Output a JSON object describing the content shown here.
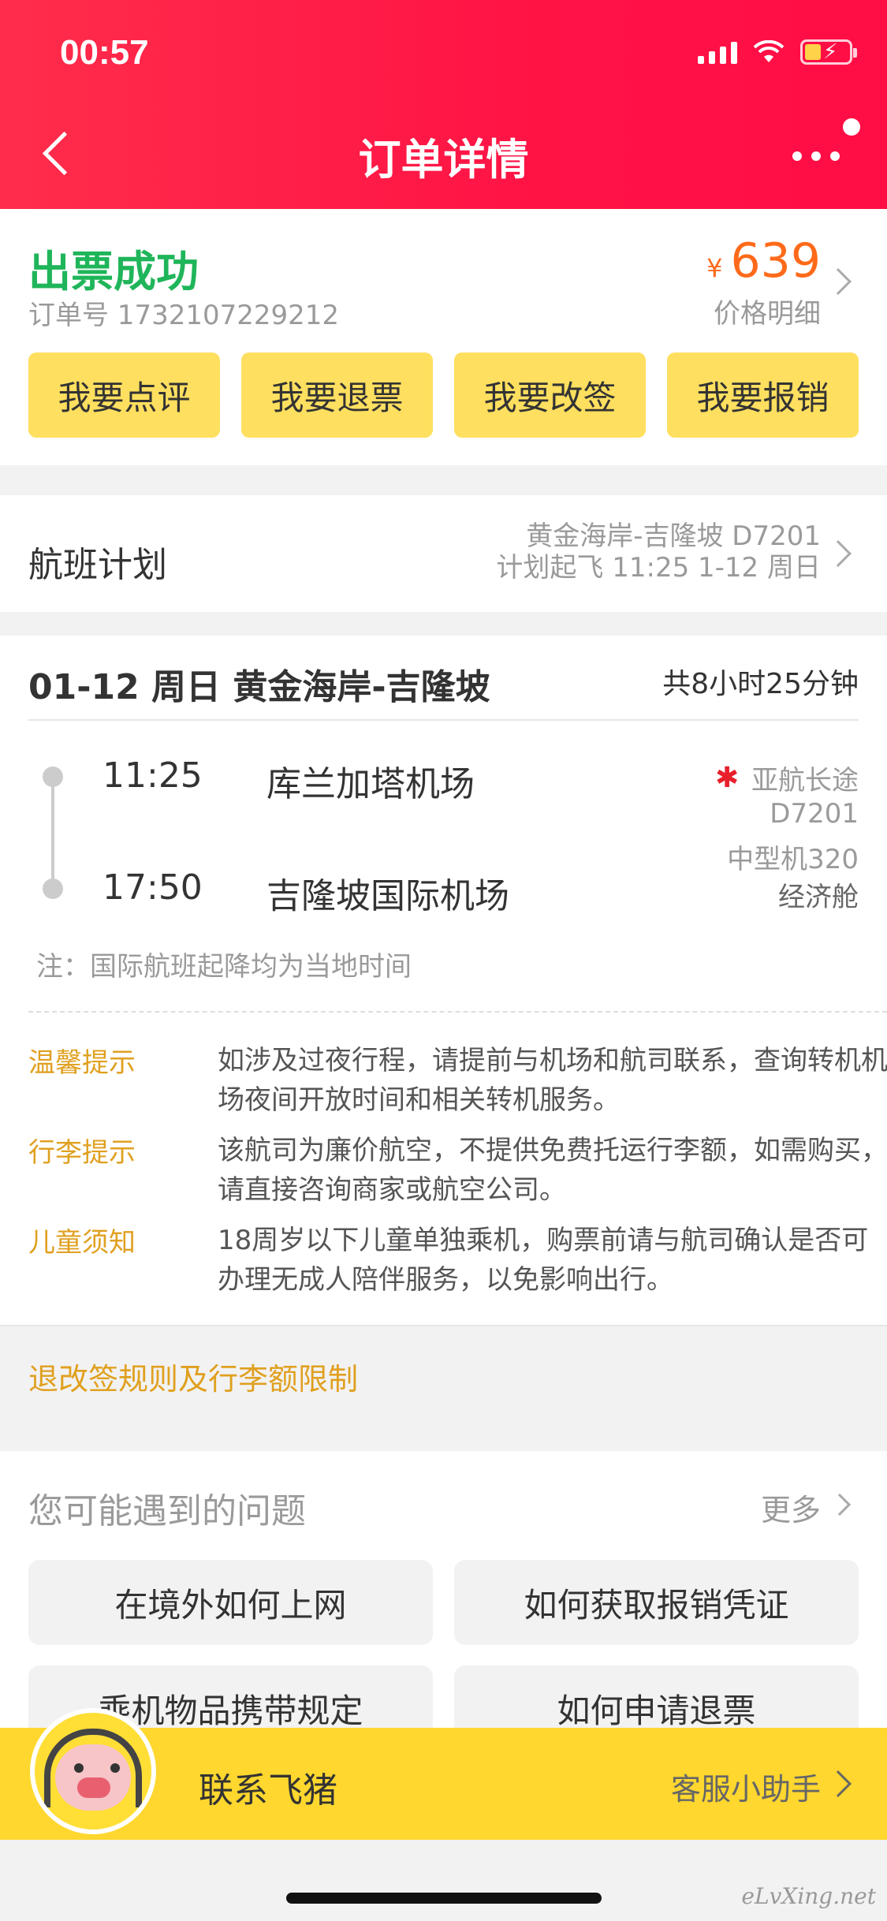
{
  "status_bar": {
    "time": "00:57"
  },
  "nav": {
    "title": "订单详情"
  },
  "order": {
    "status": "出票成功",
    "order_no": "订单号 1732107229212",
    "currency": "¥",
    "price": "639",
    "price_detail": "价格明细",
    "actions": [
      "我要点评",
      "我要退票",
      "我要改签",
      "我要报销"
    ]
  },
  "plan": {
    "label": "航班计划",
    "route": "黄金海岸-吉隆坡 D7201",
    "departure": "计划起飞 11:25 1-12 周日"
  },
  "segment": {
    "title": "01-12 周日 黄金海岸-吉隆坡",
    "duration": "共8小时25分钟",
    "dep_time": "11:25",
    "dep_airport": "库兰加塔机场",
    "arr_time": "17:50",
    "arr_airport": "吉隆坡国际机场",
    "airline": "亚航长途",
    "flight_no": "D7201",
    "aircraft": "中型机320",
    "cabin": "经济舱",
    "note": "注：国际航班起降均为当地时间"
  },
  "tips": [
    {
      "label": "温馨提示",
      "text": "如涉及过夜行程，请提前与机场和航司联系，查询转机机场夜间开放时间和相关转机服务。"
    },
    {
      "label": "行李提示",
      "text": "该航司为廉价航空，不提供免费托运行李额，如需购买，请直接咨询商家或航空公司。"
    },
    {
      "label": "儿童须知",
      "text": "18周岁以下儿童单独乘机，购票前请与航司确认是否可办理无成人陪伴服务，以免影响出行。"
    }
  ],
  "rules_link": "退改签规则及行李额限制",
  "faq": {
    "title": "您可能遇到的问题",
    "more": "更多",
    "items": [
      "在境外如何上网",
      "如何获取报销凭证",
      "乘机物品携带规定",
      "如何申请退票"
    ]
  },
  "contact": {
    "label": "联系飞猪",
    "assistant": "客服小助手"
  },
  "watermark": "eLvXing.net",
  "colors": {
    "header": "#ff1345",
    "success": "#1fb55a",
    "price": "#ff6a1a",
    "action": "#ffdf5f",
    "tip": "#e0a020",
    "contact_bar": "#ffd72e"
  }
}
